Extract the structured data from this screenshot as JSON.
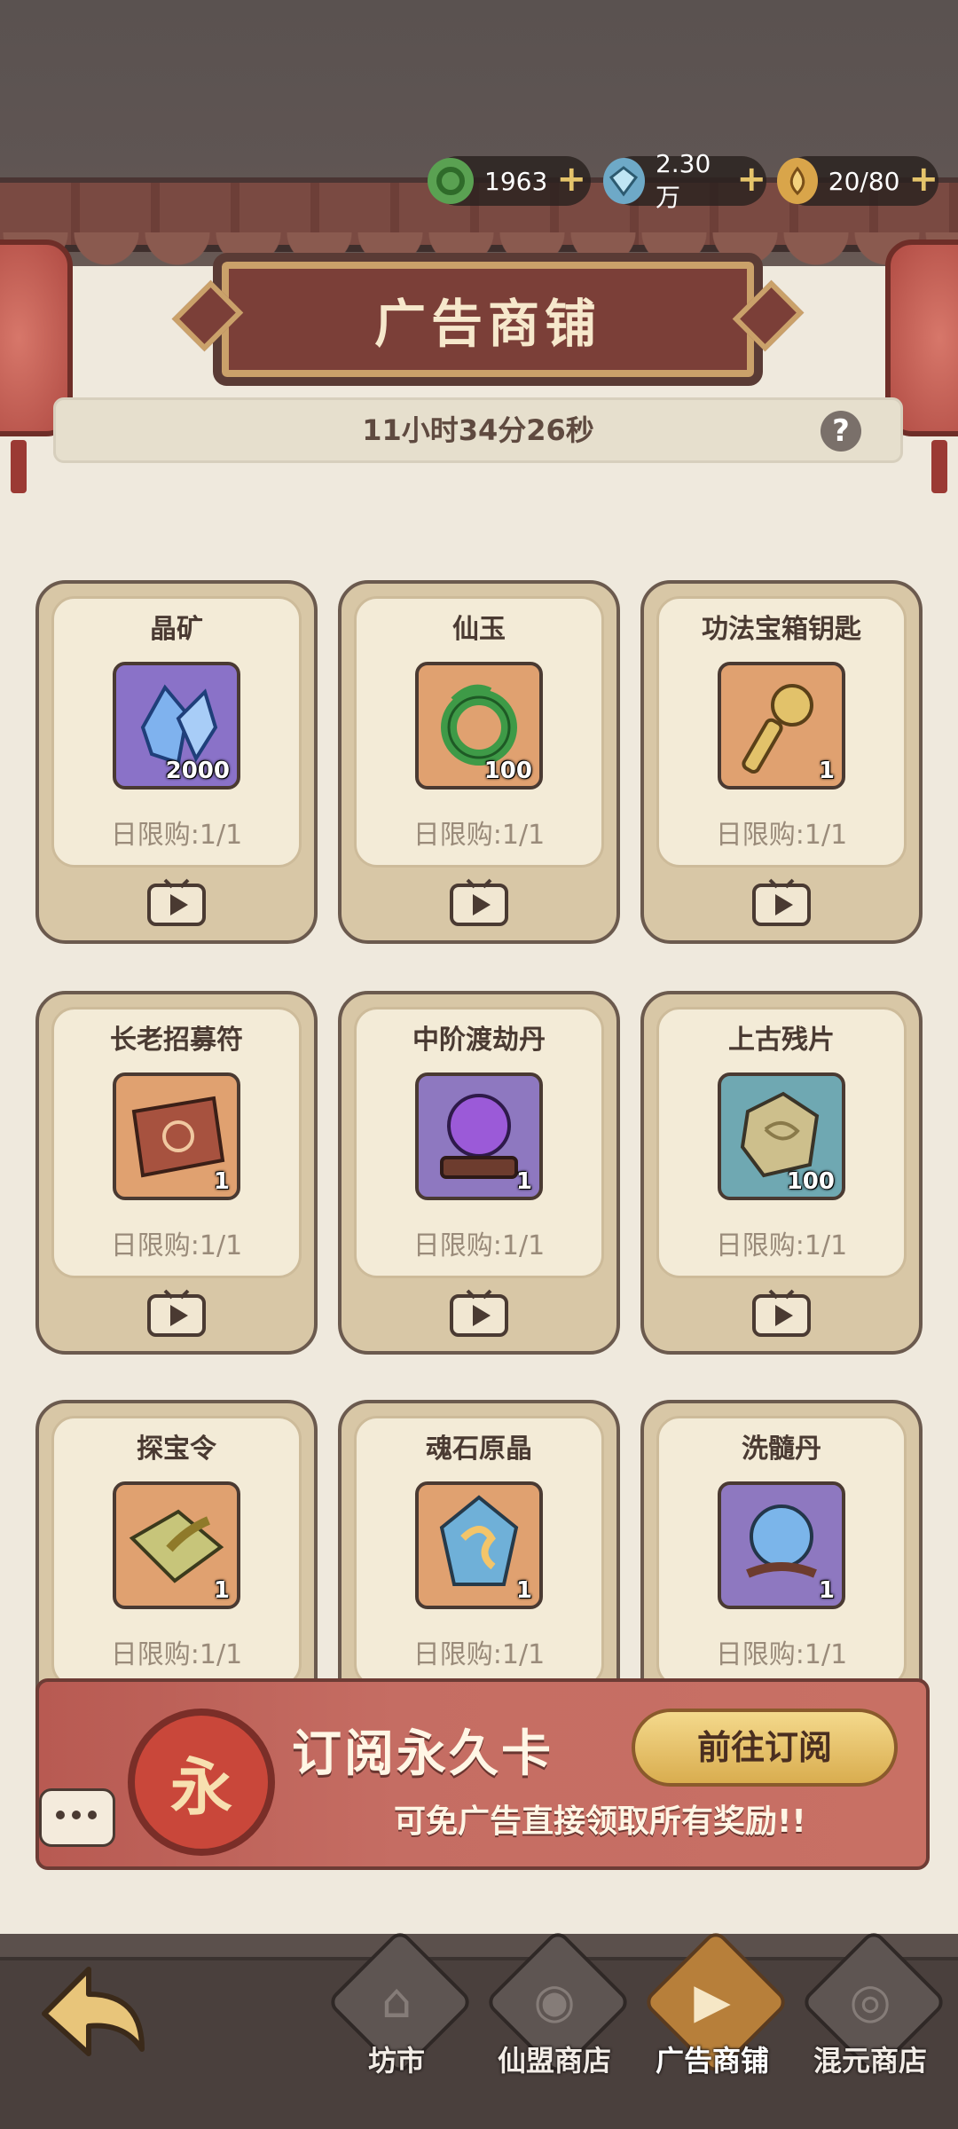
{
  "currencies": [
    {
      "icon": "jade-icon",
      "value": "1963"
    },
    {
      "icon": "crystal-icon",
      "value": "2.30万"
    },
    {
      "icon": "stamina-icon",
      "value": "20/80"
    }
  ],
  "header": {
    "title": "广告商铺"
  },
  "timer": {
    "text": "11小时34分26秒",
    "help": "?"
  },
  "items": [
    {
      "name": "晶矿",
      "qty": "2000",
      "limit": "日限购:1/1"
    },
    {
      "name": "仙玉",
      "qty": "100",
      "limit": "日限购:1/1"
    },
    {
      "name": "功法宝箱钥匙",
      "qty": "1",
      "limit": "日限购:1/1"
    },
    {
      "name": "长老招募符",
      "qty": "1",
      "limit": "日限购:1/1"
    },
    {
      "name": "中阶渡劫丹",
      "qty": "1",
      "limit": "日限购:1/1"
    },
    {
      "name": "上古残片",
      "qty": "100",
      "limit": "日限购:1/1"
    },
    {
      "name": "探宝令",
      "qty": "1",
      "limit": "日限购:1/1"
    },
    {
      "name": "魂石原晶",
      "qty": "1",
      "limit": "日限购:1/1"
    },
    {
      "name": "洗髓丹",
      "qty": "1",
      "limit": "日限购:1/1"
    }
  ],
  "banner": {
    "emblem": "永",
    "title": "订阅永久卡",
    "subtitle": "可免广告直接领取所有奖励!!",
    "button": "前往订阅"
  },
  "nav": {
    "back": "back-arrow-icon",
    "tabs": [
      {
        "label": "坊市",
        "active": false
      },
      {
        "label": "仙盟商店",
        "active": false
      },
      {
        "label": "广告商铺",
        "active": true
      },
      {
        "label": "混元商店",
        "active": false
      }
    ]
  },
  "colors": {
    "accent": "#b77f3a",
    "banner": "#c56d63",
    "title": "#7b3f38"
  }
}
